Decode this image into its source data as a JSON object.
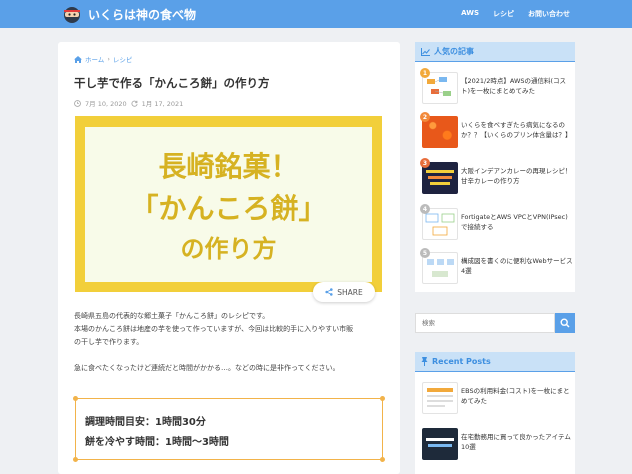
{
  "header": {
    "site_title": "いくらは神の食べ物",
    "nav": [
      "AWS",
      "レシピ",
      "お問い合わせ"
    ]
  },
  "article": {
    "breadcrumb": [
      "ホーム",
      "レシピ"
    ],
    "title": "干し芋で作る「かんころ餅」の作り方",
    "published": "7月 10, 2020",
    "updated": "1月 17, 2021",
    "eyecatch": [
      "長崎銘菓！",
      "「かんころ餅」",
      "の作り方"
    ],
    "share_label": "SHARE",
    "paragraphs": [
      "長崎県五島の代表的な郷土菓子「かんころ餅」のレシピです。",
      "本場のかんころ餅は地産の芋を使って作っていますが、今回は比較的手に入りやすい市販",
      "の干し芋で作ります。",
      "急に食べたくなったけど連続だと時間がかかる…。などの時に是非作ってください。"
    ],
    "time_box": {
      "line1": "調理時間目安：1時間30分",
      "line2": "餅を冷やす時間：1時間〜3時間"
    }
  },
  "sidebar": {
    "popular_title": "人気の記事",
    "popular": [
      {
        "rank": "1",
        "text": "【2021/2時点】AWSの通信料(コスト)を一枚にまとめてみた"
      },
      {
        "rank": "2",
        "text": "いくらを食べすぎたら病気になるのか？？【いくらのプリン体含量は？】"
      },
      {
        "rank": "3",
        "text": "大阪インデアンカレーの再現レシピ！甘辛カレーの作り方"
      },
      {
        "rank": "4",
        "text": "FortigateとAWS VPCとVPN(IPsec)で接続する"
      },
      {
        "rank": "5",
        "text": "構成図を書くのに便利なWebサービス4選"
      }
    ],
    "search_placeholder": "検索",
    "recent_title": "Recent Posts",
    "recent": [
      {
        "text": "EBSの利用料金(コスト)を一枚にまとめてみた"
      },
      {
        "text": "在宅勤務用に買って良かったアイテム10選"
      }
    ]
  },
  "colors": {
    "header": "#5aa0e8",
    "eyecatch_frame": "#f2cf3a",
    "eyecatch_text": "#d6b222",
    "time_border": "#f2b34a",
    "rank_1": "#f2a93b",
    "rank_2": "#f28a3b",
    "rank_3": "#e86d3b",
    "rank_4": "#bbbbbb",
    "rank_5": "#bbbbbb"
  }
}
